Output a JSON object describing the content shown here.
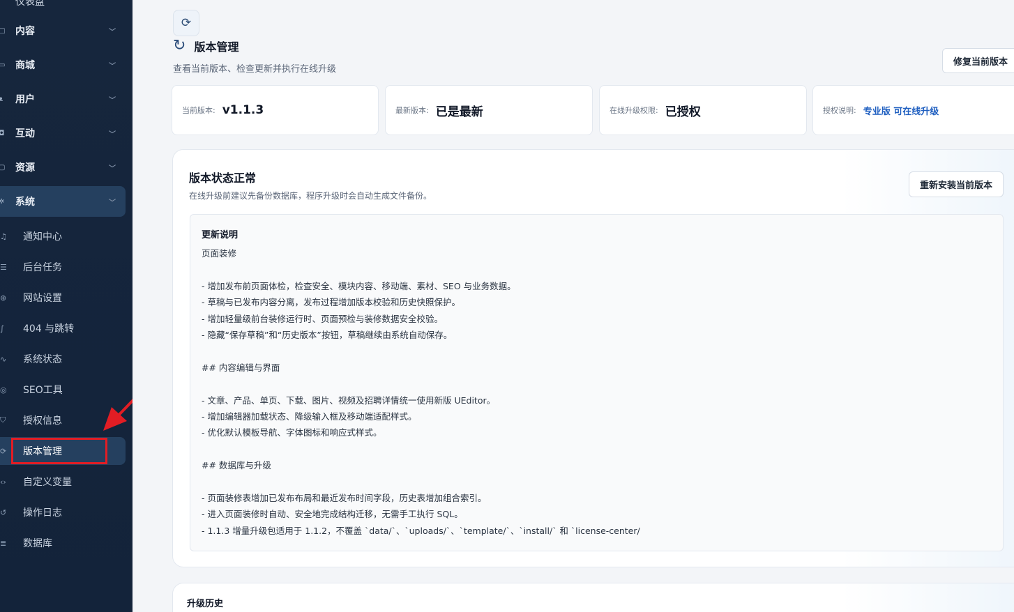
{
  "sidebar": {
    "top_partial": "仪表盘",
    "groups": [
      {
        "label": "内容",
        "icon": "content-icon"
      },
      {
        "label": "商城",
        "icon": "shop-icon"
      },
      {
        "label": "用户",
        "icon": "user-icon"
      },
      {
        "label": "互动",
        "icon": "interaction-icon"
      },
      {
        "label": "资源",
        "icon": "resource-icon"
      },
      {
        "label": "系统",
        "icon": "system-icon"
      }
    ],
    "items": [
      {
        "label": "通知中心",
        "icon": "bell-icon"
      },
      {
        "label": "后台任务",
        "icon": "list-icon"
      },
      {
        "label": "网站设置",
        "icon": "globe-icon"
      },
      {
        "label": "404 与跳转",
        "icon": "redirect-icon"
      },
      {
        "label": "系统状态",
        "icon": "pulse-icon"
      },
      {
        "label": "SEO工具",
        "icon": "target-icon"
      },
      {
        "label": "授权信息",
        "icon": "shield-icon"
      },
      {
        "label": "版本管理",
        "icon": "sync-icon"
      },
      {
        "label": "自定义变量",
        "icon": "code-icon"
      },
      {
        "label": "操作日志",
        "icon": "history-icon"
      },
      {
        "label": "数据库",
        "icon": "database-icon"
      }
    ],
    "active_item": "版本管理"
  },
  "header": {
    "title": "版本管理",
    "subtitle": "查看当前版本、检查更新并执行在线升级",
    "repair_button": "修复当前版本"
  },
  "info_cards": [
    {
      "label": "当前版本:",
      "value": "v1.1.3"
    },
    {
      "label": "最新版本:",
      "value": "已是最新"
    },
    {
      "label": "在线升级权限:",
      "value": "已授权"
    },
    {
      "label": "授权说明:",
      "value": "专业版 可在线升级"
    }
  ],
  "status": {
    "title": "版本状态正常",
    "subtitle": "在线升级前建议先备份数据库，程序升级时会自动生成文件备份。",
    "reinstall_button": "重新安装当前版本",
    "notes_title": "更新说明",
    "notes": [
      "页面装修",
      "",
      "- 增加发布前页面体检，检查安全、模块内容、移动端、素材、SEO 与业务数据。",
      "- 草稿与已发布内容分离，发布过程增加版本校验和历史快照保护。",
      "- 增加轻量级前台装修运行时、页面预检与装修数据安全校验。",
      "- 隐藏“保存草稿”和“历史版本”按钮，草稿继续由系统自动保存。",
      "",
      "## 内容编辑与界面",
      "",
      "- 文章、产品、单页、下载、图片、视频及招聘详情统一使用新版 UEditor。",
      "- 增加编辑器加载状态、降级输入框及移动端适配样式。",
      "- 优化默认模板导航、字体图标和响应式样式。",
      "",
      "## 数据库与升级",
      "",
      "- 页面装修表增加已发布布局和最近发布时间字段，历史表增加组合索引。",
      "- 进入页面装修时自动、安全地完成结构迁移，无需手工执行 SQL。",
      "- 1.1.3 增量升级包适用于 1.1.2，不覆盖 `data/`、`uploads/`、`template/`、`install/` 和 `license-center/"
    ]
  },
  "history": {
    "title": "升级历史"
  },
  "colors": {
    "sidebar_bg": "#16263d",
    "sidebar_active": "#25405f",
    "accent_blue": "#1f5fc0",
    "highlight_red": "#e21d24"
  }
}
